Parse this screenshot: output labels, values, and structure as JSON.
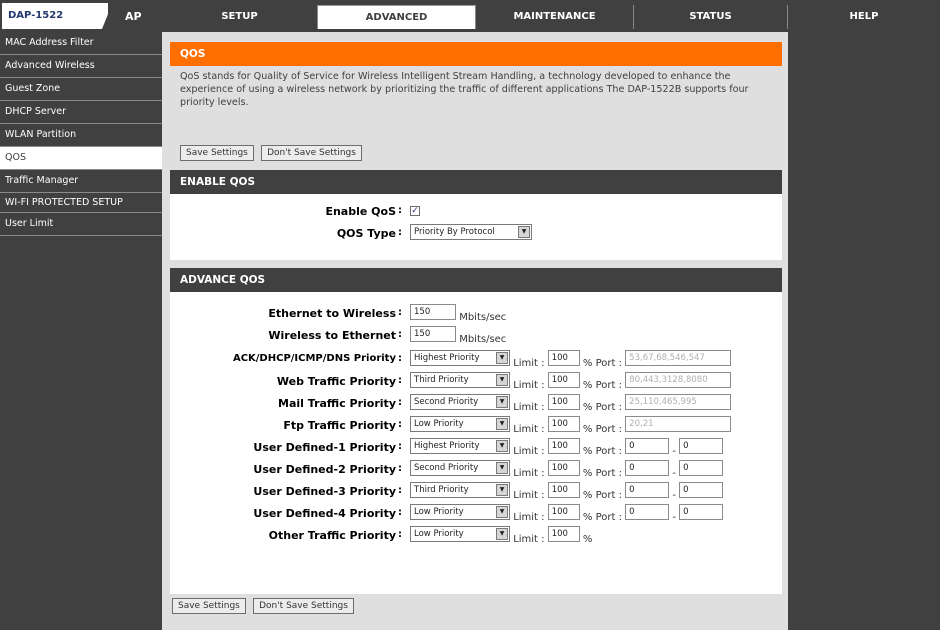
{
  "header": {
    "model": "DAP-1522",
    "mode": "AP",
    "tabs": [
      {
        "label": "SETUP"
      },
      {
        "label": "ADVANCED"
      },
      {
        "label": "MAINTENANCE"
      },
      {
        "label": "STATUS"
      },
      {
        "label": "HELP"
      }
    ],
    "active_tab": "ADVANCED"
  },
  "sidebar": {
    "items": [
      {
        "label": "MAC Address Filter"
      },
      {
        "label": "Advanced Wireless"
      },
      {
        "label": "Guest Zone"
      },
      {
        "label": "DHCP Server"
      },
      {
        "label": "WLAN Partition"
      },
      {
        "label": "QOS"
      },
      {
        "label": "Traffic Manager"
      },
      {
        "label": "WI-FI PROTECTED SETUP"
      },
      {
        "label": "User Limit"
      }
    ],
    "selected": "QOS"
  },
  "qos": {
    "title": "QOS",
    "description": "QoS stands for Quality of Service for Wireless Intelligent Stream Handling, a technology developed to enhance the experience of using a wireless network by prioritizing the traffic of different applications The DAP-1522B supports four priority levels.",
    "save_label": "Save Settings",
    "dont_save_label": "Don't Save Settings"
  },
  "enable_qos": {
    "title": "ENABLE QOS",
    "enable_label": "Enable QoS",
    "enabled": true,
    "type_label": "QOS Type",
    "type_value": "Priority By Protocol"
  },
  "advance_qos": {
    "title": "ADVANCE QOS",
    "eth_to_wireless_label": "Ethernet to Wireless",
    "eth_to_wireless_value": "150",
    "wireless_to_eth_label": "Wireless to Ethernet",
    "wireless_to_eth_value": "150",
    "unit": "Mbits/sec",
    "limit_label": "Limit :",
    "percent": "%",
    "port_label": "Port :",
    "rows": [
      {
        "label": "ACK/DHCP/ICMP/DNS Priority",
        "priority": "Highest Priority",
        "limit": "100",
        "port": "53,67,68,546,547"
      },
      {
        "label": "Web Traffic Priority",
        "priority": "Third Priority",
        "limit": "100",
        "port": "80,443,3128,8080"
      },
      {
        "label": "Mail Traffic Priority",
        "priority": "Second Priority",
        "limit": "100",
        "port": "25,110,465,995"
      },
      {
        "label": "Ftp Traffic Priority",
        "priority": "Low Priority",
        "limit": "100",
        "port": "20,21"
      },
      {
        "label": "User Defined-1 Priority",
        "priority": "Highest Priority",
        "limit": "100",
        "port_from": "0",
        "port_to": "0"
      },
      {
        "label": "User Defined-2 Priority",
        "priority": "Second Priority",
        "limit": "100",
        "port_from": "0",
        "port_to": "0"
      },
      {
        "label": "User Defined-3 Priority",
        "priority": "Third Priority",
        "limit": "100",
        "port_from": "0",
        "port_to": "0"
      },
      {
        "label": "User Defined-4 Priority",
        "priority": "Low Priority",
        "limit": "100",
        "port_from": "0",
        "port_to": "0"
      },
      {
        "label": "Other Traffic Priority",
        "priority": "Low Priority",
        "limit": "100"
      }
    ],
    "save_label": "Save Settings",
    "dont_save_label": "Don't Save Settings"
  },
  "colors": {
    "dark": "#404040",
    "orange": "#ff6f00",
    "content_bg": "#dfdfdf"
  }
}
